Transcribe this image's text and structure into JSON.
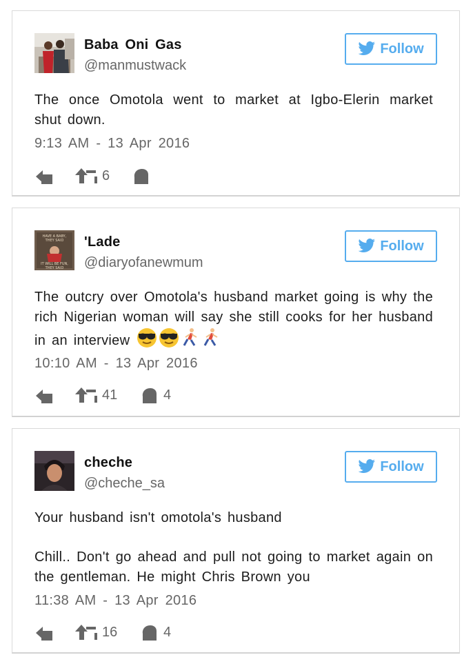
{
  "colors": {
    "accent": "#55acee",
    "icon": "#666666",
    "text": "#1c1c1c"
  },
  "tweets": [
    {
      "name": "Baba  Oni Gas",
      "handle": "@manmustwack",
      "follow_label": "Follow",
      "text": "The once Omotola  went  to market  at  Igbo-Elerin  market  shut down.",
      "time": "9:13  AM - 13 Apr  2016",
      "retweets": "6",
      "likes": ""
    },
    {
      "name": "'Lade",
      "handle": "@diaryofanewmum",
      "follow_label": "Follow",
      "avatar_text": [
        "HAVE A BABY,",
        "THEY SAID",
        "IT WILL BE FUN,",
        "THEY SAID"
      ],
      "text": "The outcry over Omotola's  husband  market going  is why  the rich Nigerian  woman  will  say  she still cooks for her husband in an interview",
      "emojis": [
        "sunglasses-face",
        "sunglasses-face",
        "running-person",
        "running-person"
      ],
      "time": "10:10  AM - 13 Apr  2016",
      "retweets": "41",
      "likes": "4"
    },
    {
      "name": "cheche",
      "handle": "@cheche_sa",
      "follow_label": "Follow",
      "text_lines": [
        "Your husband  isn't  omotola's  husband",
        "Chill.. Don't  go  ahead  and  pull  not  going  to  market  again  on the  gentleman.  He  might  Chris  Brown  you"
      ],
      "time": "11:38  AM - 13 Apr  2016",
      "retweets": "16",
      "likes": "4"
    }
  ]
}
